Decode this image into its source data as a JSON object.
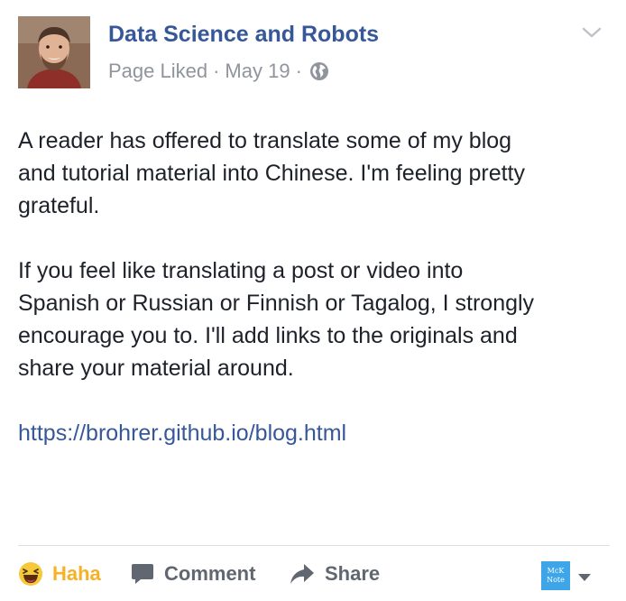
{
  "post": {
    "page_name": "Data Science and Robots",
    "status": "Page Liked",
    "separator": "·",
    "date": "May 19",
    "paragraphs": [
      "A reader has offered to translate some of my blog\nand tutorial material into Chinese. I'm feeling pretty\ngrateful.",
      "If you feel like translating a post or video into\nSpanish or Russian or Finnish or Tagalog, I strongly\nencourage you to. I'll add links to the originals and\nshare your material around."
    ],
    "link": "https://brohrer.github.io/blog.html",
    "icons": {
      "privacy": "globe-icon",
      "menu": "chevron-down-icon"
    }
  },
  "actions": {
    "reaction_label": "Haha",
    "comment_label": "Comment",
    "share_label": "Share",
    "icons": [
      "haha-emoji-icon",
      "comment-icon",
      "share-icon"
    ]
  },
  "extension": {
    "badge_line1": "McK",
    "badge_line2": "Note",
    "caret_icon": "caret-down-icon"
  },
  "colors": {
    "link_blue": "#365899",
    "meta_gray": "#90949c",
    "haha_yellow": "#f7b125",
    "action_gray": "#606770"
  }
}
